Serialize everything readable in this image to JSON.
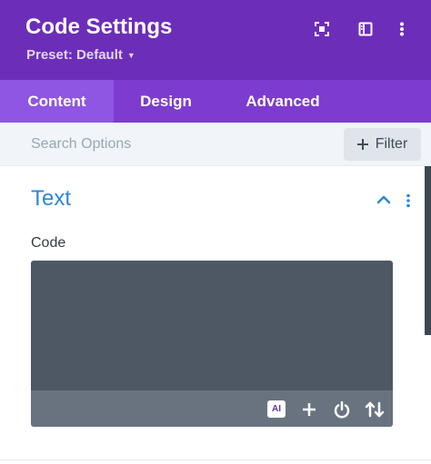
{
  "header": {
    "title": "Code Settings",
    "preset_label": "Preset: Default",
    "icons": [
      "focus-icon",
      "sidebar-icon",
      "more-vertical-icon"
    ]
  },
  "tabs": [
    {
      "label": "Content",
      "active": true
    },
    {
      "label": "Design",
      "active": false
    },
    {
      "label": "Advanced",
      "active": false
    }
  ],
  "search": {
    "placeholder": "Search Options",
    "value": "",
    "filter_label": "Filter"
  },
  "section": {
    "title": "Text",
    "expanded": true
  },
  "field": {
    "label": "Code",
    "value": ""
  },
  "editor_toolbar": {
    "ai_label": "AI",
    "icons": [
      "ai-icon",
      "plus-icon",
      "power-icon",
      "sort-icon"
    ]
  },
  "colors": {
    "header_bg": "#6c2eb9",
    "tabs_bg": "#7d3bd0",
    "active_tab_bg": "#8f55e3",
    "accent": "#2b87da",
    "editor_bg": "#4e5864"
  }
}
